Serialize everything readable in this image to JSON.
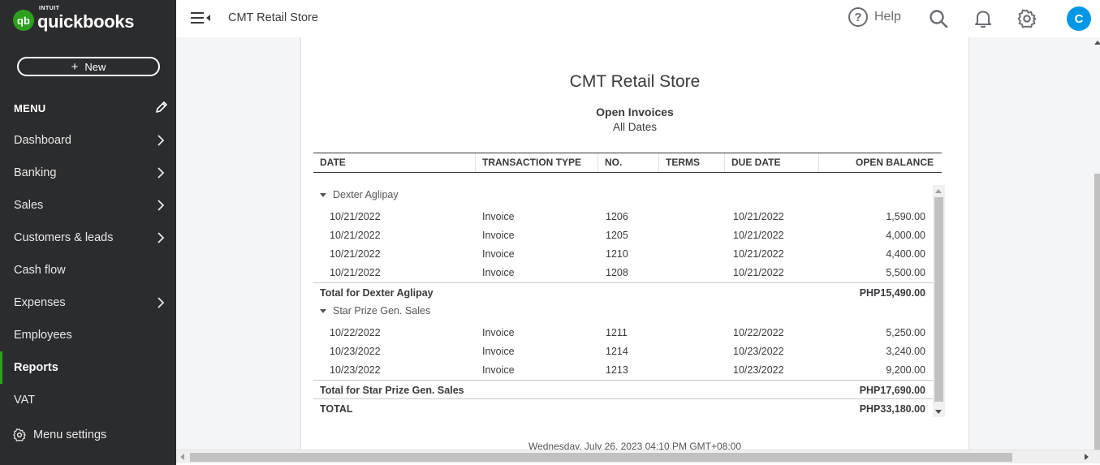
{
  "app": {
    "logo_intuit": "INTUIT",
    "logo_name": "quickbooks",
    "logo_badge": "qb",
    "new_button": "New",
    "menu_header": "MENU",
    "menu_settings": "Menu settings"
  },
  "sidebar": {
    "items": [
      {
        "label": "Dashboard",
        "chevron": true
      },
      {
        "label": "Banking",
        "chevron": true
      },
      {
        "label": "Sales",
        "chevron": true
      },
      {
        "label": "Customers & leads",
        "chevron": true
      },
      {
        "label": "Cash flow",
        "chevron": false
      },
      {
        "label": "Expenses",
        "chevron": true
      },
      {
        "label": "Employees",
        "chevron": false
      },
      {
        "label": "Reports",
        "chevron": false,
        "active": true
      },
      {
        "label": "VAT",
        "chevron": false
      }
    ]
  },
  "topbar": {
    "company_name": "CMT Retail Store",
    "help_label": "Help",
    "avatar_initial": "C"
  },
  "report": {
    "company": "CMT Retail Store",
    "title": "Open Invoices",
    "subtitle": "All Dates",
    "columns": [
      "DATE",
      "TRANSACTION TYPE",
      "NO.",
      "TERMS",
      "DUE DATE",
      "OPEN BALANCE"
    ],
    "groups": [
      {
        "name": "Dexter Aglipay",
        "rows": [
          {
            "date": "10/21/2022",
            "type": "Invoice",
            "no": "1206",
            "terms": "",
            "due": "10/21/2022",
            "balance": "1,590.00"
          },
          {
            "date": "10/21/2022",
            "type": "Invoice",
            "no": "1205",
            "terms": "",
            "due": "10/21/2022",
            "balance": "4,000.00"
          },
          {
            "date": "10/21/2022",
            "type": "Invoice",
            "no": "1210",
            "terms": "",
            "due": "10/21/2022",
            "balance": "4,400.00"
          },
          {
            "date": "10/21/2022",
            "type": "Invoice",
            "no": "1208",
            "terms": "",
            "due": "10/21/2022",
            "balance": "5,500.00"
          }
        ],
        "total_label": "Total for Dexter Aglipay",
        "total": "PHP15,490.00"
      },
      {
        "name": "Star Prize Gen. Sales",
        "rows": [
          {
            "date": "10/22/2022",
            "type": "Invoice",
            "no": "1211",
            "terms": "",
            "due": "10/22/2022",
            "balance": "5,250.00"
          },
          {
            "date": "10/23/2022",
            "type": "Invoice",
            "no": "1214",
            "terms": "",
            "due": "10/23/2022",
            "balance": "3,240.00"
          },
          {
            "date": "10/23/2022",
            "type": "Invoice",
            "no": "1213",
            "terms": "",
            "due": "10/23/2022",
            "balance": "9,200.00"
          }
        ],
        "total_label": "Total for Star Prize Gen. Sales",
        "total": "PHP17,690.00"
      }
    ],
    "grand_total_label": "TOTAL",
    "grand_total": "PHP33,180.00",
    "timestamp": "Wednesday, July 26, 2023   04:10 PM GMT+08:00"
  },
  "colors": {
    "sidebar_bg": "#2b2c2e",
    "brand_green": "#2ca01c",
    "avatar_blue": "#0097e6"
  }
}
